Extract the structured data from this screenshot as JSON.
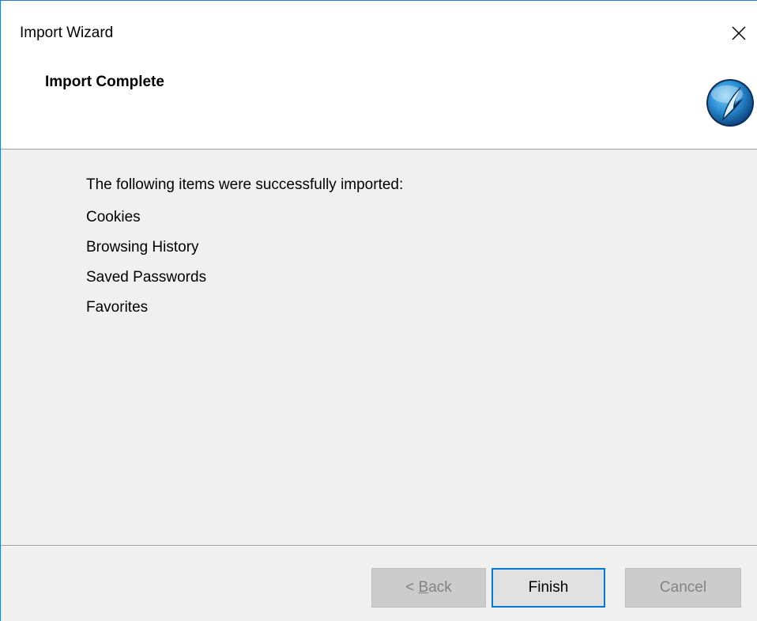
{
  "window": {
    "title": "Import Wizard"
  },
  "header": {
    "title": "Import Complete",
    "logo_icon": "iron-browser-logo-icon"
  },
  "body": {
    "intro": "The following items were successfully imported:",
    "items": [
      "Cookies",
      "Browsing History",
      "Saved Passwords",
      "Favorites"
    ]
  },
  "footer": {
    "back_prefix": "< ",
    "back_mnemonic": "B",
    "back_rest": "ack",
    "finish_label": "Finish",
    "cancel_label": "Cancel"
  },
  "colors": {
    "accent": "#0078d7",
    "body_background": "#f0f0f0",
    "disabled_button": "#cccccc",
    "disabled_text": "#838383"
  }
}
